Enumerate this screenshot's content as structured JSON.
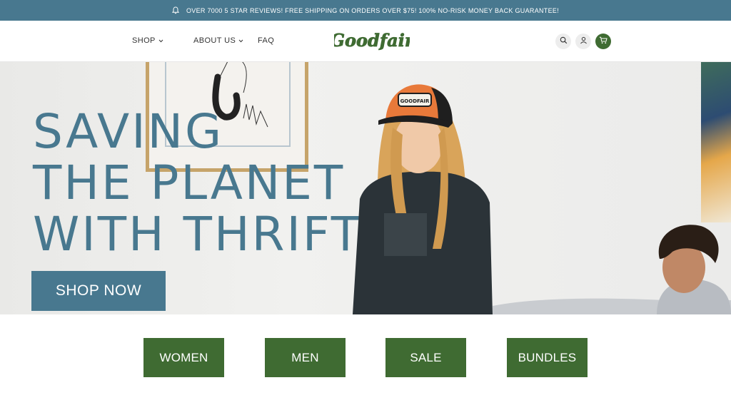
{
  "announcement": {
    "icon": "bell-icon",
    "text": "OVER 7000 5 STAR REVIEWS! FREE SHIPPING ON ORDERS OVER $75! 100% NO-RISK MONEY BACK GUARANTEE!"
  },
  "nav": {
    "shop": "SHOP",
    "about": "ABOUT US",
    "faq": "FAQ"
  },
  "brand": {
    "logo_text": "Goodfair",
    "color": "#3f6b32"
  },
  "header_icons": [
    "search-icon",
    "account-icon",
    "cart-icon"
  ],
  "hero": {
    "title_lines": [
      "SAVING",
      "THE PLANET",
      "WITH THRIFT"
    ],
    "cta": "SHOP NOW",
    "cap_text": "GOODFAIR"
  },
  "categories": [
    "WOMEN",
    "MEN",
    "SALE",
    "BUNDLES"
  ],
  "colors": {
    "announcement_bg": "#48788f",
    "hero_accent": "#48788f",
    "category_bg": "#3f6b32"
  }
}
